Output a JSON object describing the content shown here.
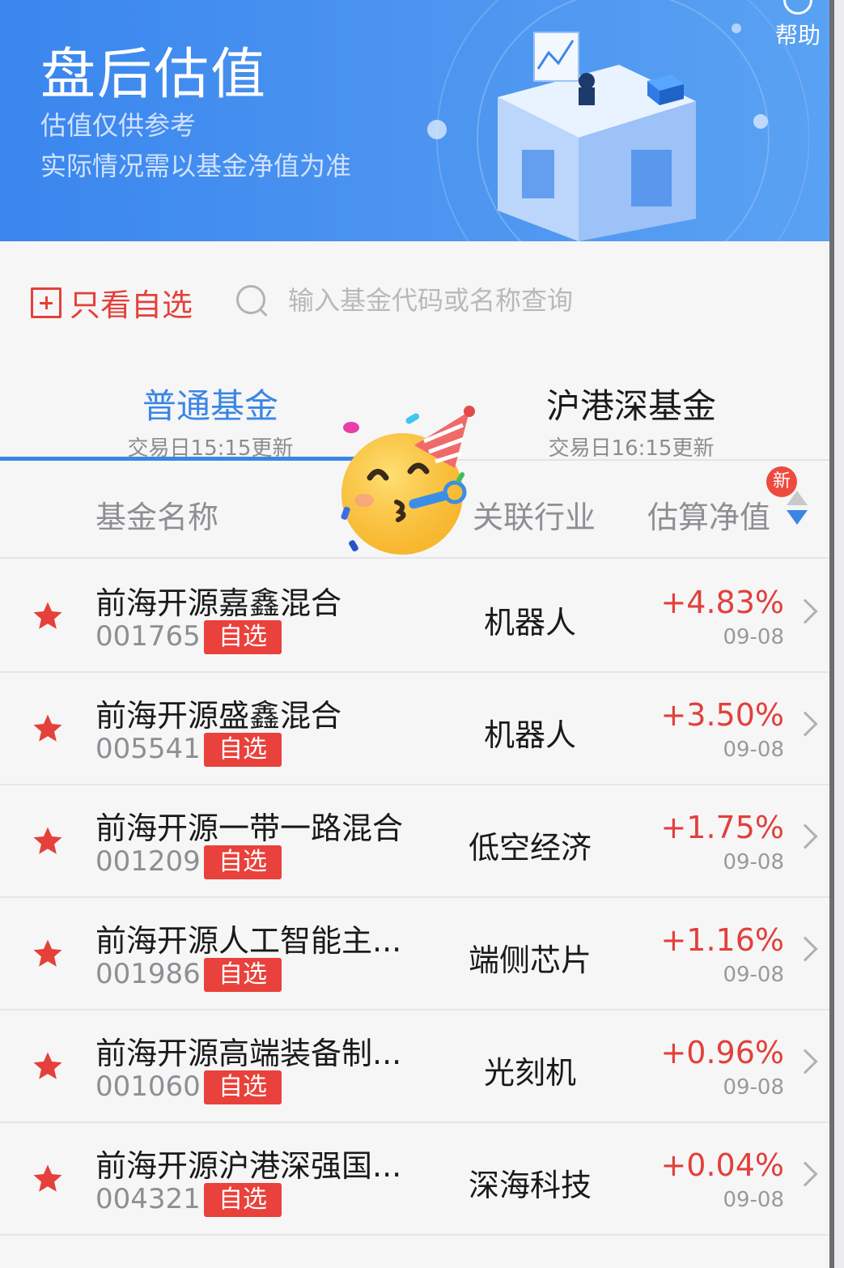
{
  "header": {
    "title": "盘后估值",
    "subtitle_line1": "估值仅供参考",
    "subtitle_line2": "实际情况需以基金净值为准",
    "help_label": "帮助"
  },
  "filter": {
    "only_favorites_label": "只看自选",
    "search_placeholder": "输入基金代码或名称查询"
  },
  "tabs": [
    {
      "label": "普通基金",
      "sub": "交易日15:15更新",
      "active": true
    },
    {
      "label": "沪港深基金",
      "sub": "交易日16:15更新",
      "active": false
    }
  ],
  "columns": {
    "name": "基金名称",
    "industry": "关联行业",
    "nav": "估算净值",
    "new_badge": "新"
  },
  "funds": [
    {
      "name": "前海开源嘉鑫混合",
      "code": "001765",
      "badge": "自选",
      "industry": "机器人",
      "change": "+4.83%",
      "date": "09-08"
    },
    {
      "name": "前海开源盛鑫混合",
      "code": "005541",
      "badge": "自选",
      "industry": "机器人",
      "change": "+3.50%",
      "date": "09-08"
    },
    {
      "name": "前海开源一带一路混合",
      "code": "001209",
      "badge": "自选",
      "industry": "低空经济",
      "change": "+1.75%",
      "date": "09-08"
    },
    {
      "name": "前海开源人工智能主...",
      "code": "001986",
      "badge": "自选",
      "industry": "端侧芯片",
      "change": "+1.16%",
      "date": "09-08"
    },
    {
      "name": "前海开源高端装备制...",
      "code": "001060",
      "badge": "自选",
      "industry": "光刻机",
      "change": "+0.96%",
      "date": "09-08"
    },
    {
      "name": "前海开源沪港深强国...",
      "code": "004321",
      "badge": "自选",
      "industry": "深海科技",
      "change": "+0.04%",
      "date": "09-08"
    }
  ],
  "colors": {
    "accent_blue": "#3b86e3",
    "positive_red": "#e2403a",
    "star_red": "#e5403a"
  },
  "icons": [
    "help-icon",
    "add-favorite-icon",
    "search-icon",
    "sort-up-icon",
    "sort-down-icon",
    "star-icon",
    "chevron-right-icon",
    "party-face-sticker"
  ]
}
